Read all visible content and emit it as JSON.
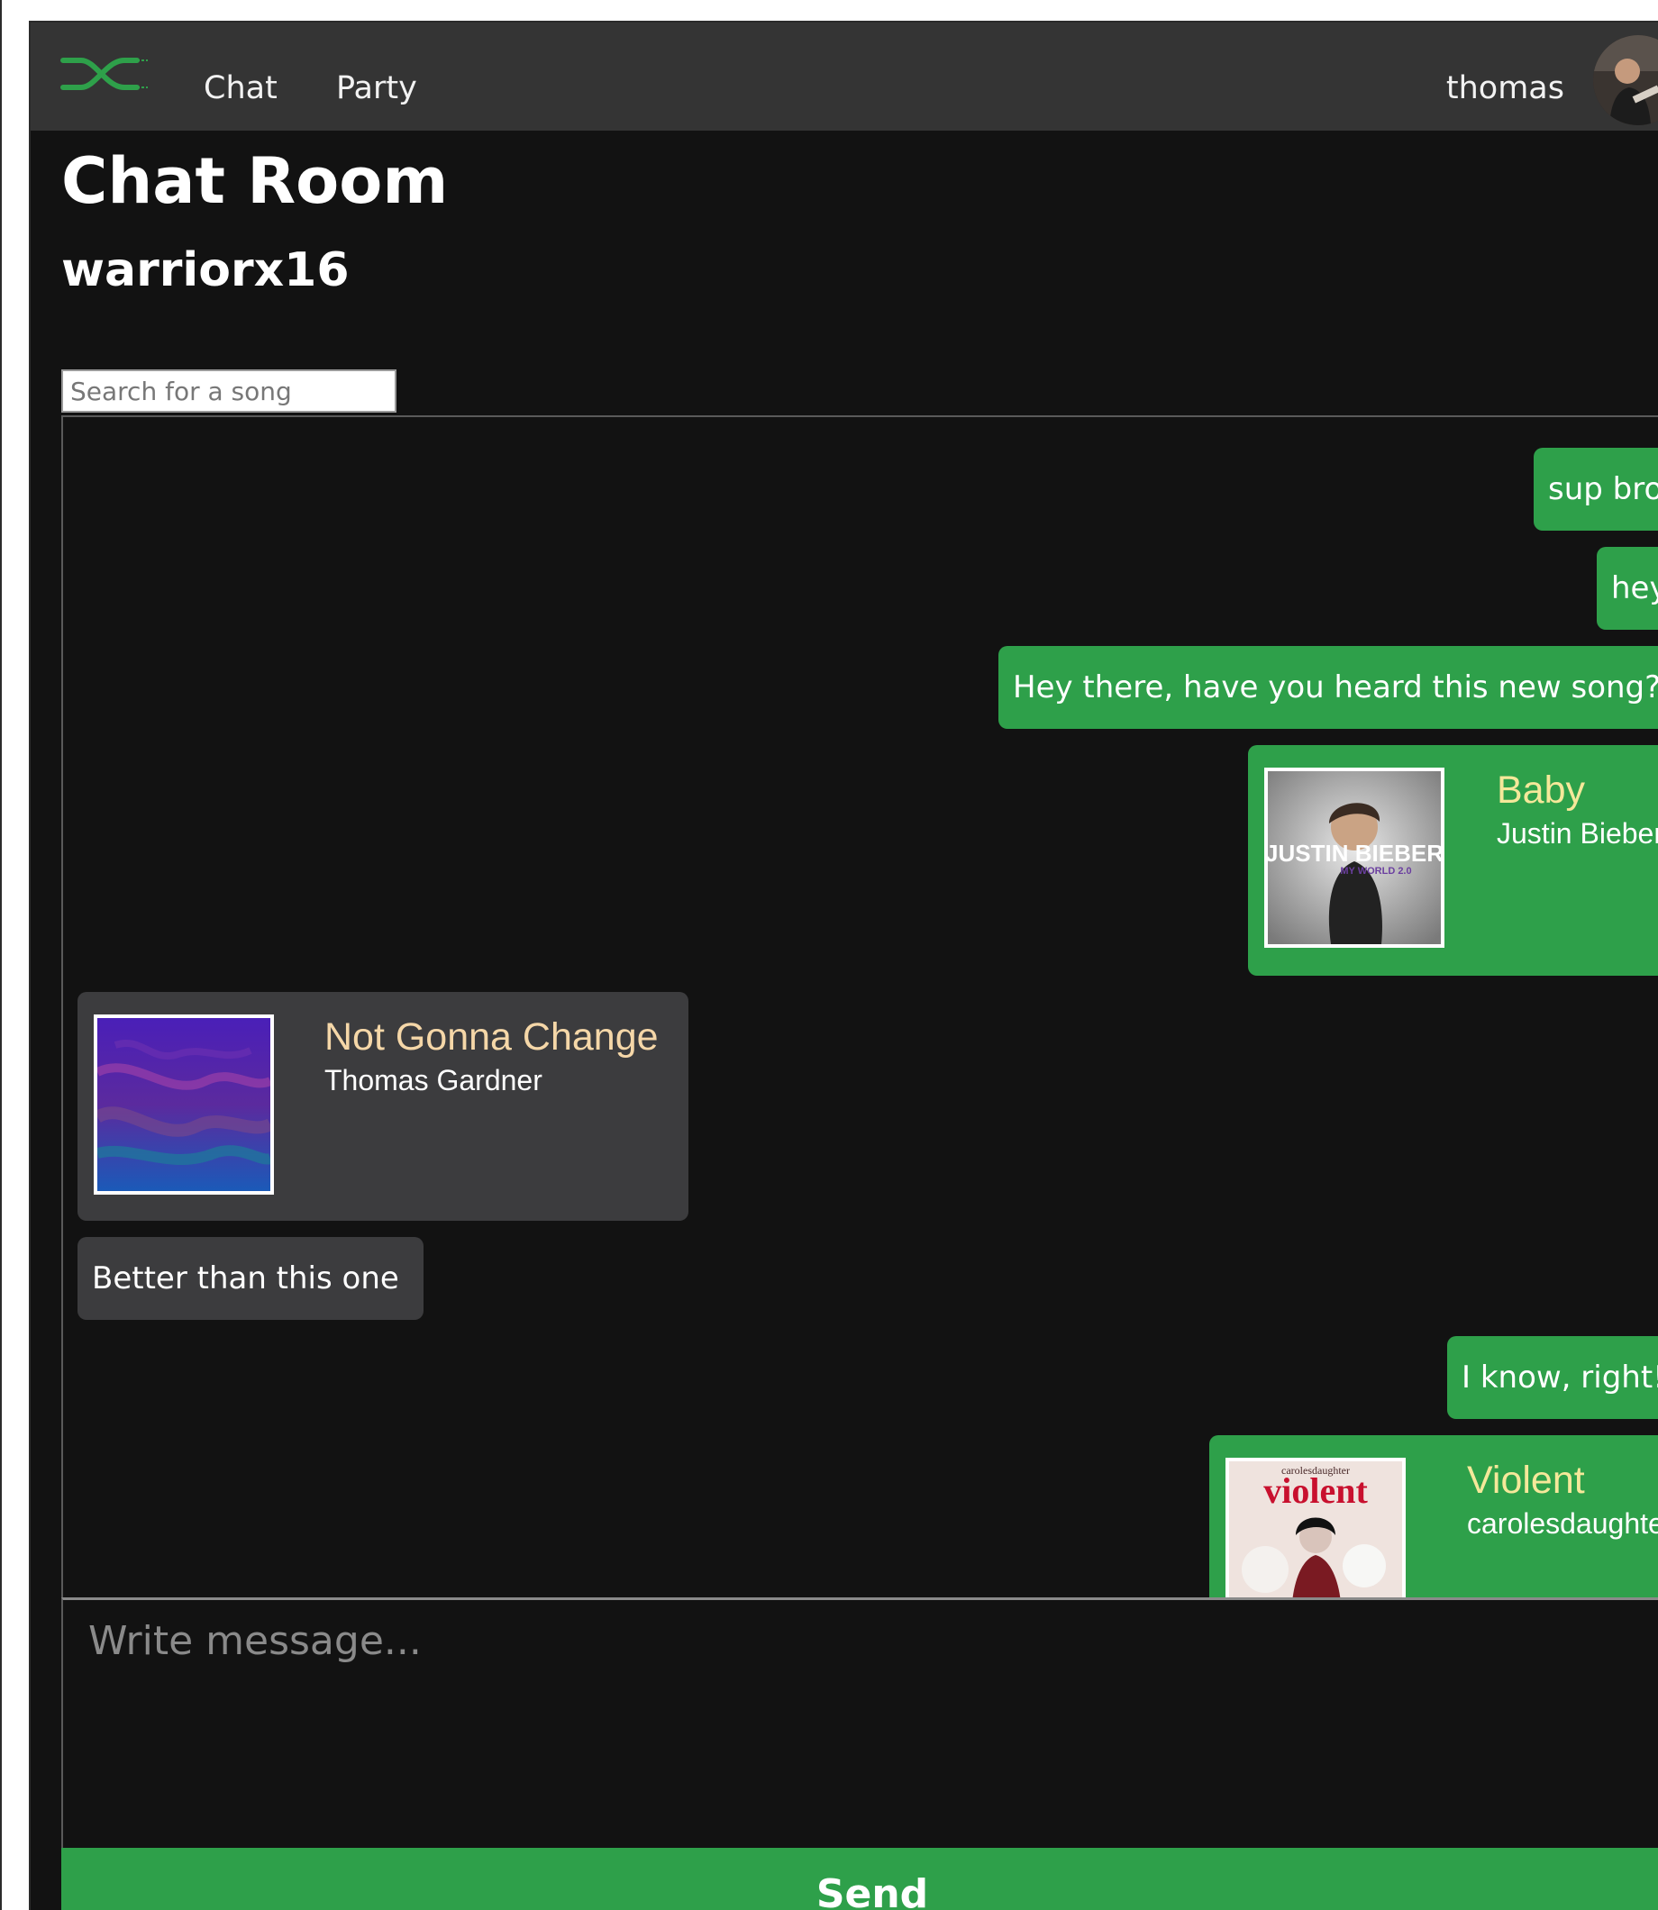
{
  "nav": {
    "links": [
      "Chat",
      "Party"
    ],
    "username": "thomas",
    "logo_icon": "crossed-audio-cables-logo",
    "avatar_icon": "user-avatar"
  },
  "page": {
    "title": "Chat Room",
    "room": "warriorx16"
  },
  "search": {
    "placeholder": "Search for a song"
  },
  "messages": [
    {
      "from": "me",
      "type": "text",
      "text": "sup bro"
    },
    {
      "from": "me",
      "type": "text",
      "text": "hey"
    },
    {
      "from": "me",
      "type": "text",
      "text": "Hey there, have you heard this new song?"
    },
    {
      "from": "me",
      "type": "song",
      "title": "Baby",
      "artist": "Justin Bieber",
      "cover_text": "JUSTIN BIEBER",
      "cover_subtext": "MY WORLD 2.0"
    },
    {
      "from": "them",
      "type": "song",
      "title": "Not Gonna Change",
      "artist": "Thomas Gardner"
    },
    {
      "from": "them",
      "type": "text",
      "text": "Better than this one"
    },
    {
      "from": "me",
      "type": "text",
      "text": "I know, right!"
    },
    {
      "from": "me",
      "type": "song",
      "title": "Violent",
      "artist": "carolesdaughter",
      "cover_text": "violent",
      "cover_subtext": "carolesdaughter"
    }
  ],
  "compose": {
    "placeholder": "Write message..."
  },
  "send_label": "Send",
  "colors": {
    "accent": "#2ea04a",
    "background": "#121212",
    "navbar": "#343434",
    "their_bubble": "#3c3c3e",
    "my_song_title": "#f5e89a",
    "their_song_title": "#f5d7a8"
  }
}
